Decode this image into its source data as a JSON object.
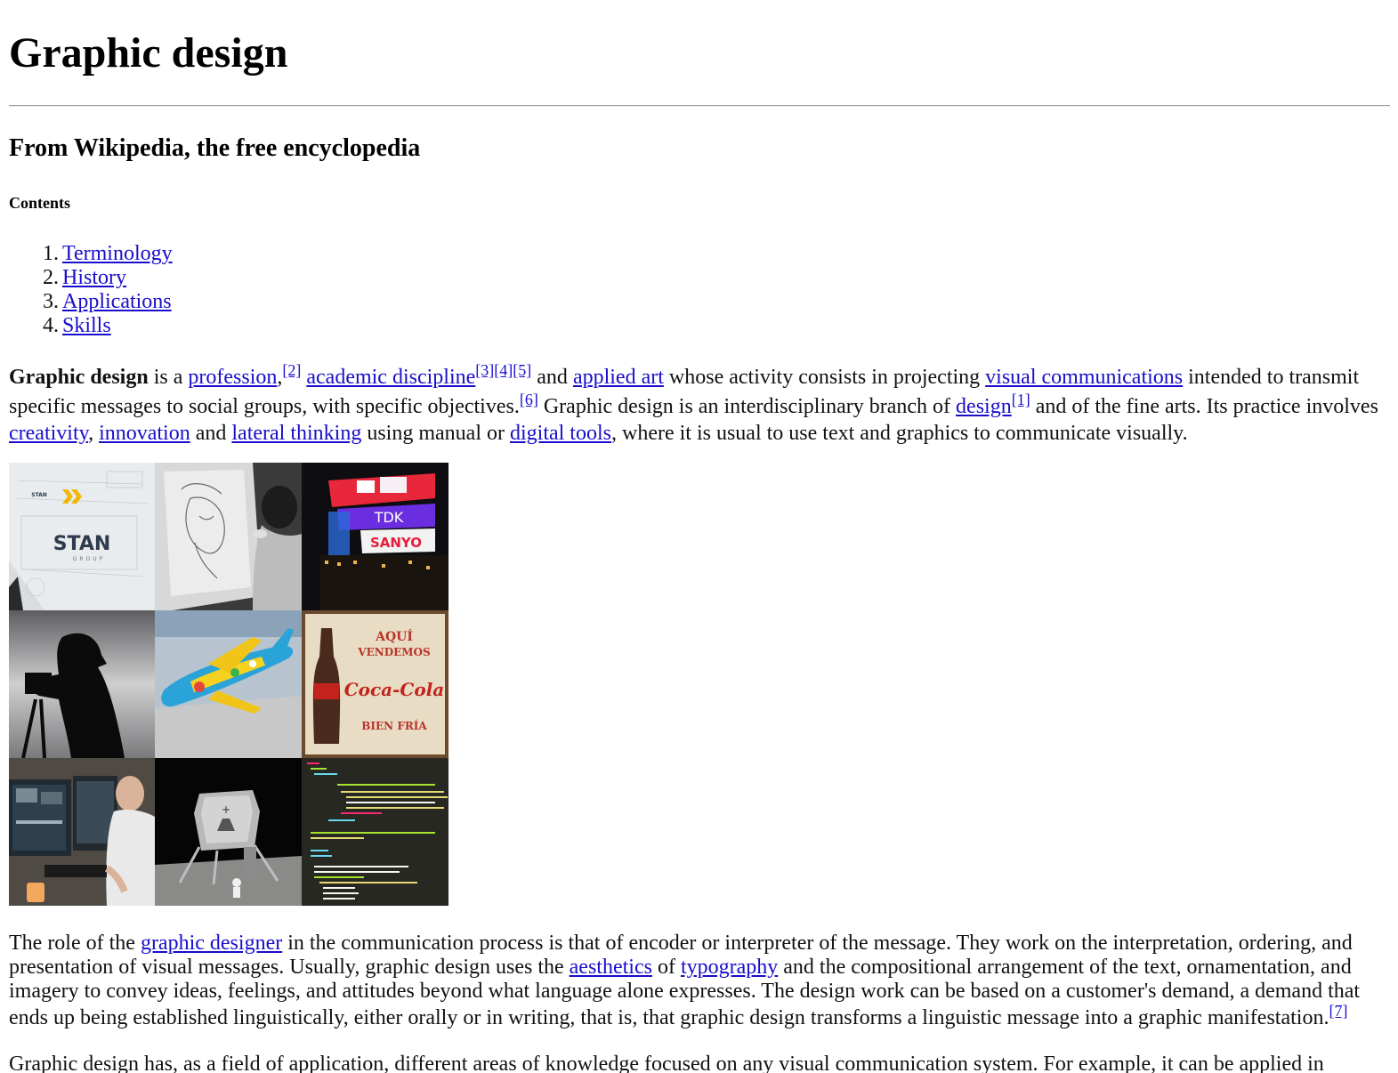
{
  "page": {
    "title": "Graphic design",
    "subtitle": "From Wikipedia, the free encyclopedia",
    "contents_heading": "Contents"
  },
  "toc": [
    {
      "num": "1.",
      "label": "Terminology"
    },
    {
      "num": "2.",
      "label": "History"
    },
    {
      "num": "3.",
      "label": "Applications"
    },
    {
      "num": "4.",
      "label": "Skills"
    }
  ],
  "intro": {
    "bold_term": "Graphic design",
    "t1": " is a ",
    "link_profession": "profession",
    "t2": ",",
    "ref_2": "[2]",
    "t3": " ",
    "link_academic": "academic discipline",
    "ref_3": "[3]",
    "ref_4": "[4]",
    "ref_5": "[5]",
    "t4": " and ",
    "link_applied_art": "applied art",
    "t5": " whose activity consists in projecting ",
    "link_visual_comm": "visual communications",
    "t6": " intended to transmit",
    "t7": "specific messages to social groups, with specific objectives.",
    "ref_6": "[6]",
    "t8": " Graphic design is an interdisciplinary branch of ",
    "link_design": "design",
    "ref_1": "[1]",
    "t9": " and of the fine arts. Its practice involves",
    "link_creativity": "creativity",
    "t10": ", ",
    "link_innovation": "innovation",
    "t11": " and ",
    "link_lateral": "lateral thinking",
    "t12": " using manual or ",
    "link_digital": "digital tools",
    "t13": ", where it is usual to use text and graphics to communicate visually."
  },
  "collage": {
    "stan_brand": "STAN",
    "stan_group": "GROUP",
    "stan_small": "STAN",
    "tdk": "TDK",
    "sanyo": "SANYO",
    "aqui": "AQUÍ",
    "vendemos": "VENDEMOS",
    "coca": "Coca-Cola",
    "bien": "BIEN FRÍA"
  },
  "role": {
    "t1": "The role of the ",
    "link_designer": "graphic designer",
    "t2": " in the communication process is that of encoder or interpreter of the message. They work on the interpretation, ordering, and",
    "t3": "presentation of visual messages. Usually, graphic design uses the ",
    "link_aesthetics": "aesthetics",
    "t4": " of ",
    "link_typography": "typography",
    "t5": " and the compositional arrangement of the text, ornamentation, and",
    "t6": "imagery to convey ideas, feelings, and attitudes beyond what language alone expresses. The design work can be based on a customer's demand, a demand that",
    "t7": "ends up being established linguistically, either orally or in writing, that is, that graphic design transforms a linguistic message into a graphic manifestation.",
    "ref_7": "[7]"
  },
  "field": {
    "t1": "Graphic design has, as a field of application, different areas of knowledge focused on any visual communication system. For example, it can be applied in"
  }
}
